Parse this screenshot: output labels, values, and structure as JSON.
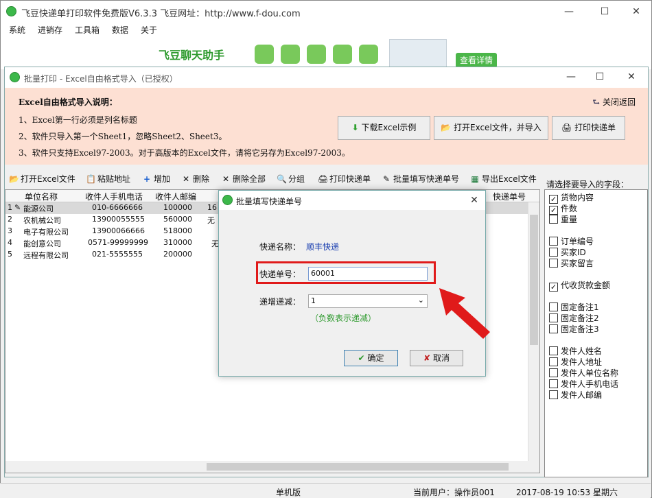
{
  "main_window": {
    "title": "飞豆快递单打印软件免费版V6.3.3  飞豆网址：http://www.f-dou.com",
    "menu": [
      "系统",
      "进销存",
      "工具箱",
      "数据",
      "关于"
    ],
    "banner_title": "飞豆聊天助手",
    "banner_cta": "查看详情"
  },
  "batch_window": {
    "title": "批量打印 - Excel自由格式导入（已授权）",
    "instructions_head": "Excel自由格式导入说明：",
    "instructions": [
      "1、Excel第一行必须是列名标题",
      "2、软件只导入第一个Sheet1，忽略Sheet2、Sheet3。",
      "3、软件只支持Excel97-2003。对于高版本的Excel文件，请将它另存为Excel97-2003。"
    ],
    "close_back": "关闭返回",
    "download_sample": "下载Excel示例",
    "open_and_import": "打开Excel文件，并导入",
    "print_express": "打印快递单",
    "toolbar": {
      "open_excel": "打开Excel文件",
      "paste_address": "粘贴地址",
      "add": "增加",
      "delete": "删除",
      "delete_all": "删除全部",
      "group": "分组",
      "print": "打印快递单",
      "batch_fill": "批量填写快递单号",
      "export": "导出Excel文件"
    },
    "grid": {
      "headers": [
        "单位名称",
        "收件人手机电话",
        "收件人邮编",
        "快递单号"
      ],
      "rows": [
        {
          "n": "1",
          "company": "能源公司",
          "phone": "010-6666666",
          "zip": "100000",
          "extra": "16"
        },
        {
          "n": "2",
          "company": "农机械公司",
          "phone": "13900055555",
          "zip": "560000",
          "extra": "无"
        },
        {
          "n": "3",
          "company": "电子有限公司",
          "phone": "13900066666",
          "zip": "518000",
          "extra": ""
        },
        {
          "n": "4",
          "company": "能创意公司",
          "phone": "0571-99999999",
          "zip": "310000",
          "extra": "无"
        },
        {
          "n": "5",
          "company": "远程有限公司",
          "phone": "021-5555555",
          "zip": "200000",
          "extra": ""
        }
      ]
    },
    "fields_label": "请选择要导入的字段：",
    "fields": [
      {
        "label": "货物内容",
        "checked": true
      },
      {
        "label": "件数",
        "checked": true
      },
      {
        "label": "重量",
        "checked": false
      },
      {
        "label": "订单编号",
        "checked": false
      },
      {
        "label": "买家ID",
        "checked": false
      },
      {
        "label": "买家留言",
        "checked": false
      },
      {
        "label": "代收货款金额",
        "checked": true
      },
      {
        "label": "固定备注1",
        "checked": false
      },
      {
        "label": "固定备注2",
        "checked": false
      },
      {
        "label": "固定备注3",
        "checked": false
      },
      {
        "label": "发件人姓名",
        "checked": false
      },
      {
        "label": "发件人地址",
        "checked": false
      },
      {
        "label": "发件人单位名称",
        "checked": false
      },
      {
        "label": "发件人手机电话",
        "checked": false
      },
      {
        "label": "发件人邮编",
        "checked": false
      }
    ]
  },
  "dialog": {
    "title": "批量填写快递单号",
    "courier_label": "快递名称：",
    "courier_value": "顺丰快递",
    "number_label": "快递单号：",
    "number_value": "60001",
    "increment_label": "递增递减：",
    "increment_value": "1",
    "hint": "（负数表示递减）",
    "ok": "确定",
    "cancel": "取消"
  },
  "status": {
    "edition": "单机版",
    "user": "当前用户：操作员001",
    "datetime": "2017-08-19 10:53 星期六"
  },
  "colors": {
    "accent_green": "#2e9a2e",
    "highlight_red": "#e01a1a",
    "link_blue": "#1a3fb0"
  }
}
